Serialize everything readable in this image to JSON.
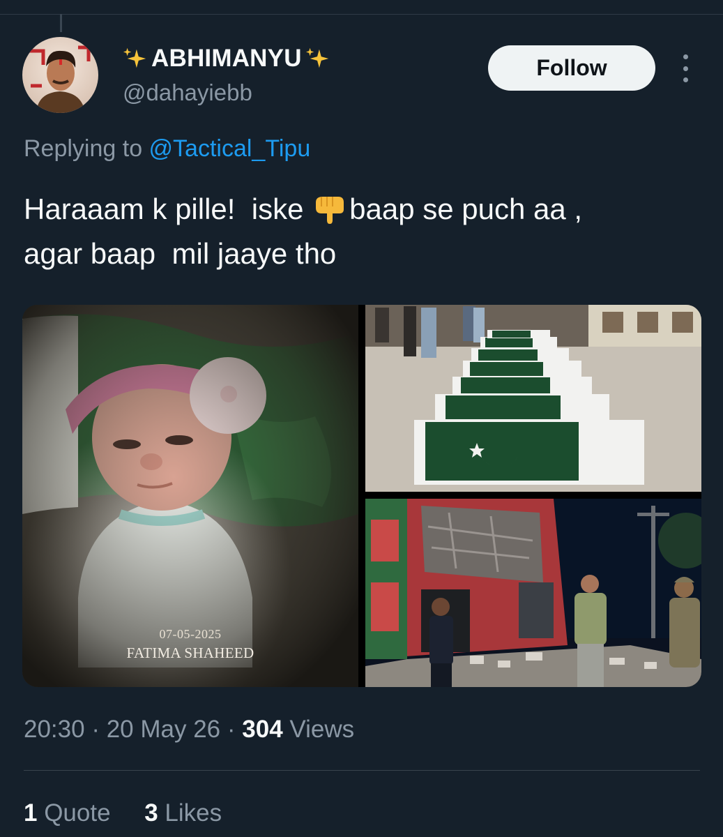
{
  "post": {
    "author": {
      "display_name": "ABHIMANYU",
      "handle": "@dahayiebb",
      "avatar_icon": "profile-avatar"
    },
    "follow_label": "Follow",
    "more_icon": "more-vertical-icon",
    "reply_prefix": "Replying to ",
    "reply_to": "@Tactical_Tipu",
    "text_line1_a": "Haraaam k pille!  iske ",
    "text_line1_b": "baap se puch aa ,",
    "text_line2": "agar baap  mil jaaye tho",
    "emoji_icon": "pointing-down-hand-emoji",
    "media": {
      "memorial_date": "07-05-2025",
      "memorial_name": "FATIMA SHAHEED"
    },
    "time": "20:30",
    "date": "20 May 26",
    "views_count": "304",
    "views_label": "Views",
    "quotes_count": "1",
    "quotes_label": "Quote",
    "likes_count": "3",
    "likes_label": "Likes"
  },
  "colors": {
    "background": "#15202b",
    "text_primary": "#f7f9f9",
    "text_secondary": "#8b98a5",
    "link": "#1d9bf0",
    "follow_bg": "#eff3f4"
  }
}
